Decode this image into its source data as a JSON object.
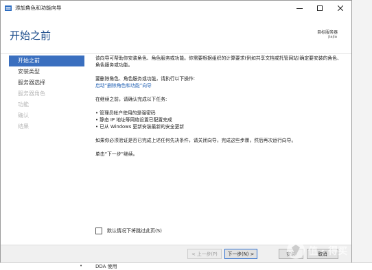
{
  "window": {
    "title": "添加角色和功能向导"
  },
  "header": {
    "page_title": "开始之前",
    "destination_label": "目标服务器",
    "destination_value": "jiajia"
  },
  "sidebar": {
    "items": [
      {
        "label": "开始之前",
        "state": "active"
      },
      {
        "label": "安装类型",
        "state": "enabled"
      },
      {
        "label": "服务器选择",
        "state": "enabled"
      },
      {
        "label": "服务器角色",
        "state": "disabled"
      },
      {
        "label": "功能",
        "state": "disabled"
      },
      {
        "label": "确认",
        "state": "disabled"
      },
      {
        "label": "结果",
        "state": "disabled"
      }
    ]
  },
  "content": {
    "intro": "该向导可帮助你安装角色、角色服务或功能。你需要根据组织的计算要求(例如共享文档或托管网站)确定要安装的角色、角色服务或功能。",
    "remove_prompt": "要删除角色、角色服务或功能，请执行以下操作:",
    "remove_link": "启动“删除角色和功能”向导",
    "confirm_prompt": "在继续之前，请确认完成以下任务:",
    "bullets": [
      "管理员帐户使用的是强密码",
      "静态 IP 地址等网络设置已配置完成",
      "已从 Windows 更新安装最新的安全更新"
    ],
    "verify_text": "如果你必须验证是否已完成上述任何先决条件，请关闭向导，完成这些步骤，然后再次运行向导。",
    "next_hint": "单击“下一步”继续。"
  },
  "skip_checkbox": {
    "label": "默认情况下将跳过此页(S)",
    "checked": false
  },
  "buttons": {
    "prev": "< 上一步(P)",
    "next": "下一步(N) >",
    "install": "安装",
    "cancel": "取消"
  },
  "background": {
    "bottom_text": "DDA 使用"
  },
  "colors": {
    "accent": "#3a6fbf",
    "title": "#1e4e8c",
    "link": "#1f5fb3"
  }
}
